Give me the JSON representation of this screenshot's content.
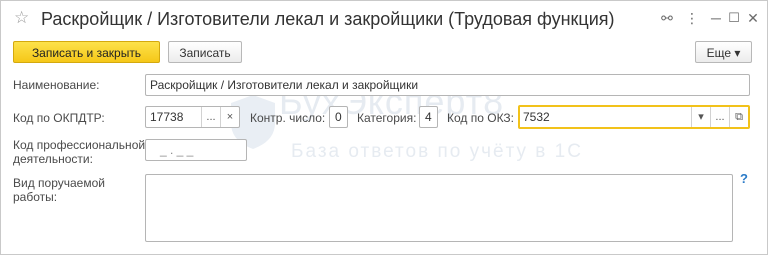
{
  "window": {
    "title": "Раскройщик / Изготовители лекал и закройщики (Трудовая функция)",
    "star_icon": "☆",
    "link_icon": "⚯",
    "menu_icon": "⋮",
    "minimize_icon": "─",
    "maximize_icon": "☐",
    "close_icon": "✕"
  },
  "toolbar": {
    "save_close_label": "Записать и закрыть",
    "save_label": "Записать",
    "more_label": "Еще ▾"
  },
  "form": {
    "name_label": "Наименование:",
    "name_value": "Раскройщик / Изготовители лекал и закройщики",
    "okpdtr_label": "Код по ОКПДТР:",
    "okpdtr_value": "17738",
    "select_btn": "...",
    "clear_btn": "×",
    "control_label": "Контр. число:",
    "control_value": "0",
    "category_label": "Категория:",
    "category_value": "4",
    "okz_label": "Код по ОКЗ:",
    "okz_value": "7532",
    "dropdown_btn": "▾",
    "open_btn": "⧉",
    "prof_label_1": "Код профессиональной",
    "prof_label_2": "деятельности:",
    "prof_value": "_ . _ _",
    "work_label_1": "Вид поручаемой",
    "work_label_2": "работы:",
    "work_value": "",
    "help_label": "?"
  },
  "watermark": {
    "brand": "БухЭксперт8",
    "tagline": "База ответов по учёту в 1С"
  },
  "colors": {
    "accent_yellow": "#f5c718",
    "focus_border": "#f2c21a",
    "help_blue": "#2b7bc8"
  }
}
